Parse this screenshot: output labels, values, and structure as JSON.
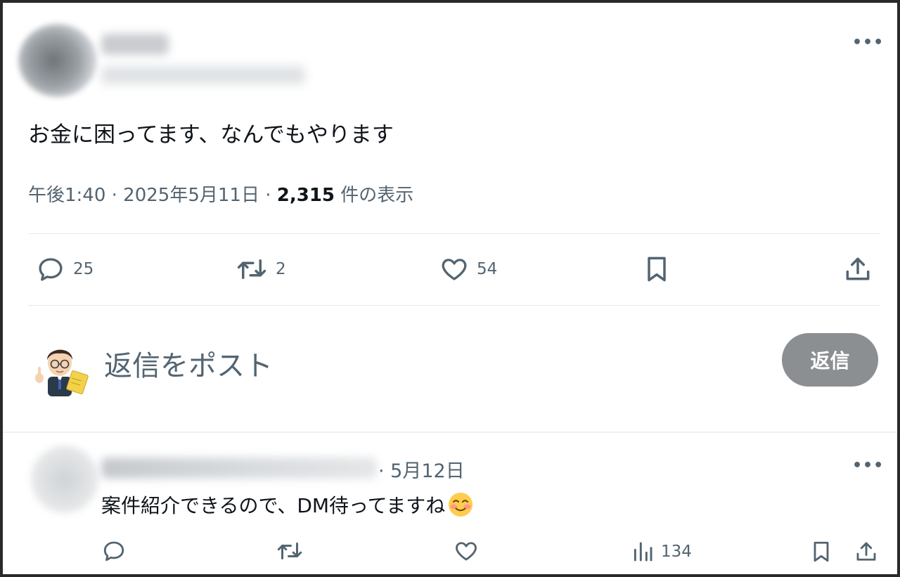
{
  "post": {
    "text": "お金に困ってます、なんでもやります",
    "meta_prefix": "午後1:40 · 2025年5月11日 · ",
    "views_count": "2,315",
    "views_suffix": " 件の表示",
    "more_label": "•••"
  },
  "actions": {
    "reply_count": "25",
    "repost_count": "2",
    "like_count": "54"
  },
  "composer": {
    "placeholder": "返信をポスト",
    "button_label": "返信"
  },
  "reply": {
    "date": "· 5月12日",
    "text": "案件紹介できるので、DM待ってますね",
    "views_count": "134",
    "more_label": "•••"
  },
  "icons": {
    "reply": "reply-icon",
    "repost": "repost-icon",
    "like": "heart-icon",
    "bookmark": "bookmark-icon",
    "share": "share-icon",
    "views": "views-icon",
    "emoji": "blushing-smile-emoji"
  },
  "colors": {
    "text_primary": "#0f1419",
    "text_secondary": "#536471",
    "reply_button_disabled": "#8b8f92"
  }
}
